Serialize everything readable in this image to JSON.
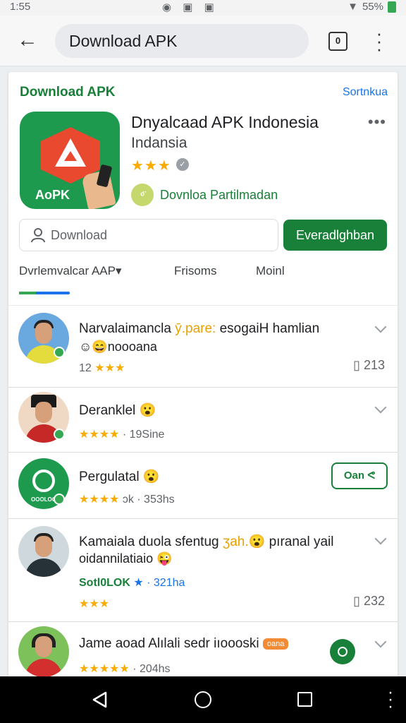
{
  "status": {
    "time": "1:55",
    "right_text": "55%",
    "battery_color": "#34a853"
  },
  "browser": {
    "url_text": "Download APK",
    "tabs_count": "0",
    "icons": {
      "back": "arrow-left-icon",
      "menu": "more-vert-icon",
      "tabs": "tabs-icon"
    }
  },
  "header": {
    "brand": "Download APK",
    "right_link": "Sortnkua"
  },
  "app": {
    "title": "Dnyalcaad APK Indonesia",
    "subtitle": "Indansia",
    "rating_stars": "★★★",
    "icon_label": "AoPK",
    "developer": "Dovnloa Partilmadan",
    "developer_icon_text": "ᵒ̈"
  },
  "search": {
    "placeholder": "Download",
    "action_label": "Everadlghban"
  },
  "tabs": [
    "Dvrlemvalcar AAP",
    "Frisoms",
    "Moinl"
  ],
  "list": [
    {
      "name_before": "Narvalaimancla ",
      "name_hl": "ȳ.pare:",
      "name_after": " esogaiH hamlian",
      "extra": "☺😄noooana",
      "rating_prefix": "12",
      "stars": "★★★",
      "meta": "",
      "count": "213"
    },
    {
      "name": "Deranklel 😮",
      "stars": "★★★★",
      "meta": "· 19Sine"
    },
    {
      "name": "Pergulatal 😮",
      "stars": "★★★★",
      "meta": "ɔk · 353hs",
      "button": "Oan ᕙ",
      "logo_text": "OOOLOO"
    },
    {
      "name_before": "Kamaiala duola sfentug ",
      "name_hl": "ʒah.",
      "name_after": "😮 pıranal yail",
      "extra": "oidannilatiaio 😜",
      "highlight": "Sotl0LOK",
      "meta": "★ · 321ha",
      "stars": "★★★",
      "count": "232"
    },
    {
      "name": "Jame aoad Alılali sedr iıoooski",
      "tag": "oana",
      "stars": "★★★★★",
      "meta": "· 204hs"
    }
  ],
  "nav": {
    "icons": [
      "back-triangle-icon",
      "home-circle-icon",
      "recents-square-icon",
      "more-vert-icon"
    ]
  }
}
